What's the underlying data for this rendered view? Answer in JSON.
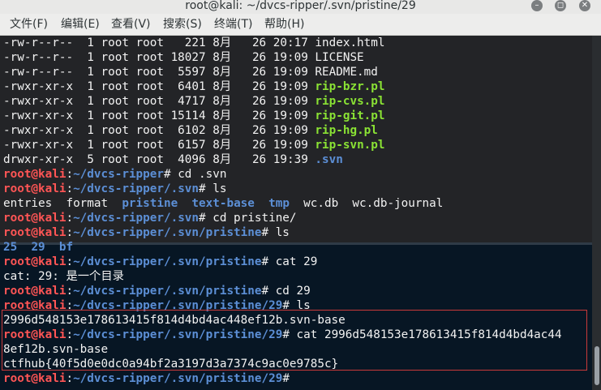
{
  "window": {
    "title": "root@kali: ~/dvcs-ripper/.svn/pristine/29",
    "controls": {
      "minimize": "–",
      "maximize": "◻",
      "close": "✕"
    }
  },
  "menu": [
    "文件(F)",
    "编辑(E)",
    "查看(V)",
    "搜索(S)",
    "终端(T)",
    "帮助(H)"
  ],
  "terminal": {
    "lines": [
      [
        {
          "t": "-rw-r--r--  1 root root   221 8月   26 20:17 index.html",
          "c": "w"
        }
      ],
      [
        {
          "t": "-rw-r--r--  1 root root 18027 8月   26 19:09 LICENSE",
          "c": "w"
        }
      ],
      [
        {
          "t": "-rw-r--r--  1 root root  5597 8月   26 19:09 README.md",
          "c": "w"
        }
      ],
      [
        {
          "t": "-rwxr-xr-x  1 root root  6401 8月   26 19:09 ",
          "c": "w"
        },
        {
          "t": "rip-bzr.pl",
          "c": "g"
        }
      ],
      [
        {
          "t": "-rwxr-xr-x  1 root root  4717 8月   26 19:09 ",
          "c": "w"
        },
        {
          "t": "rip-cvs.pl",
          "c": "g"
        }
      ],
      [
        {
          "t": "-rwxr-xr-x  1 root root 15114 8月   26 19:09 ",
          "c": "w"
        },
        {
          "t": "rip-git.pl",
          "c": "g"
        }
      ],
      [
        {
          "t": "-rwxr-xr-x  1 root root  6102 8月   26 19:09 ",
          "c": "w"
        },
        {
          "t": "rip-hg.pl",
          "c": "g"
        }
      ],
      [
        {
          "t": "-rwxr-xr-x  1 root root  6157 8月   26 19:09 ",
          "c": "w"
        },
        {
          "t": "rip-svn.pl",
          "c": "g"
        }
      ],
      [
        {
          "t": "drwxr-xr-x  5 root root  4096 8月   26 19:39 ",
          "c": "w"
        },
        {
          "t": ".svn",
          "c": "b"
        }
      ],
      [
        {
          "t": "root@kali",
          "c": "p"
        },
        {
          "t": ":",
          "c": "w"
        },
        {
          "t": "~/dvcs-ripper",
          "c": "b"
        },
        {
          "t": "# cd .svn",
          "c": "w"
        }
      ],
      [
        {
          "t": "root@kali",
          "c": "p"
        },
        {
          "t": ":",
          "c": "w"
        },
        {
          "t": "~/dvcs-ripper/.svn",
          "c": "b"
        },
        {
          "t": "# ls",
          "c": "w"
        }
      ],
      [
        {
          "t": "entries  format  ",
          "c": "w"
        },
        {
          "t": "pristine",
          "c": "b"
        },
        {
          "t": "  ",
          "c": "w"
        },
        {
          "t": "text-base",
          "c": "b"
        },
        {
          "t": "  ",
          "c": "w"
        },
        {
          "t": "tmp",
          "c": "b"
        },
        {
          "t": "  wc.db  wc.db-journal",
          "c": "w"
        }
      ],
      [
        {
          "t": "root@kali",
          "c": "p"
        },
        {
          "t": ":",
          "c": "w"
        },
        {
          "t": "~/dvcs-ripper/.svn",
          "c": "b"
        },
        {
          "t": "# cd pristine/",
          "c": "w"
        }
      ],
      [
        {
          "t": "root@kali",
          "c": "p"
        },
        {
          "t": ":",
          "c": "w"
        },
        {
          "t": "~/dvcs-ripper/.svn/pristine",
          "c": "b"
        },
        {
          "t": "# ls",
          "c": "w"
        }
      ],
      [
        {
          "t": "25",
          "c": "b"
        },
        {
          "t": "  ",
          "c": "w"
        },
        {
          "t": "29",
          "c": "b"
        },
        {
          "t": "  ",
          "c": "w"
        },
        {
          "t": "bf",
          "c": "b"
        }
      ],
      [
        {
          "t": "root@kali",
          "c": "p"
        },
        {
          "t": ":",
          "c": "w"
        },
        {
          "t": "~/dvcs-ripper/.svn/pristine",
          "c": "b"
        },
        {
          "t": "# cat 29",
          "c": "w"
        }
      ],
      [
        {
          "t": "cat: 29: 是一个目录",
          "c": "w"
        }
      ],
      [
        {
          "t": "root@kali",
          "c": "p"
        },
        {
          "t": ":",
          "c": "w"
        },
        {
          "t": "~/dvcs-ripper/.svn/pristine",
          "c": "b"
        },
        {
          "t": "# cd 29",
          "c": "w"
        }
      ],
      [
        {
          "t": "root@kali",
          "c": "p"
        },
        {
          "t": ":",
          "c": "w"
        },
        {
          "t": "~/dvcs-ripper/.svn/pristine/29",
          "c": "b"
        },
        {
          "t": "# ls",
          "c": "w"
        }
      ],
      [
        {
          "t": "2996d548153e178613415f814d4bd4ac448ef12b.svn-base",
          "c": "w"
        }
      ],
      [
        {
          "t": "root@kali",
          "c": "p"
        },
        {
          "t": ":",
          "c": "w"
        },
        {
          "t": "~/dvcs-ripper/.svn/pristine/29",
          "c": "b"
        },
        {
          "t": "# cat 2996d548153e178613415f814d4bd4ac44",
          "c": "w"
        }
      ],
      [
        {
          "t": "8ef12b.svn-base",
          "c": "w"
        }
      ],
      [
        {
          "t": "ctfhub{40f5d0e0dc0a94bf2a3197d3a7374c9ac0e9785c}",
          "c": "w"
        }
      ],
      [
        {
          "t": "root@kali",
          "c": "p"
        },
        {
          "t": ":",
          "c": "w"
        },
        {
          "t": "~/dvcs-ripper/.svn/pristine/29",
          "c": "b"
        },
        {
          "t": "# ",
          "c": "w"
        }
      ]
    ]
  }
}
